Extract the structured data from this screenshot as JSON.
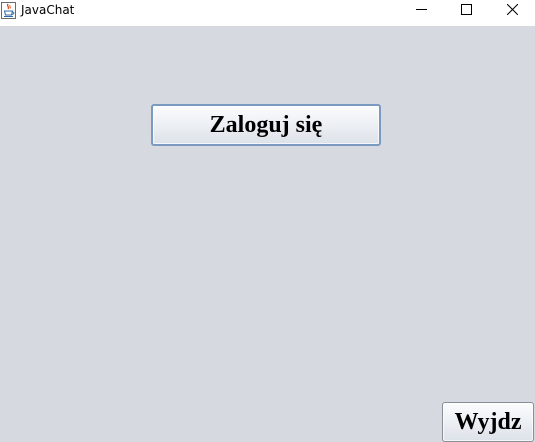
{
  "window": {
    "title": "JavaChat",
    "icon": "java-cup-icon",
    "controls": {
      "minimize_icon": "minimize-icon",
      "maximize_icon": "maximize-icon",
      "close_icon": "close-icon"
    }
  },
  "main": {
    "login_button_label": "Zaloguj się",
    "exit_button_label": "Wyjdz"
  },
  "colors": {
    "content_background": "#d6d9e0",
    "titlebar_background": "#ffffff",
    "button_focus_border": "#7a9ac0"
  }
}
